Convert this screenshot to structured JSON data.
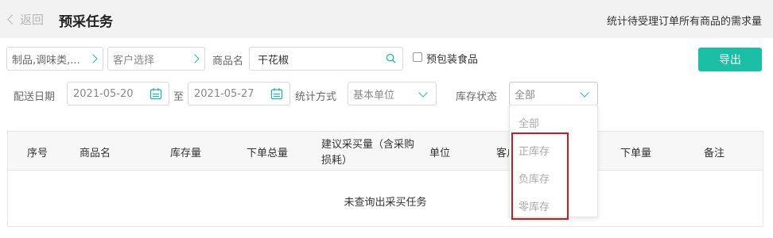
{
  "header": {
    "back_label": "返回",
    "title": "预采任务",
    "note": "统计待受理订单所有商品的需求量"
  },
  "filters": {
    "category_value": "制品,调味类,...",
    "customer_placeholder": "客户选择",
    "product_name_label": "商品名",
    "product_name_value": "干花椒",
    "prepackaged_label": "预包装食品",
    "export_label": "导出",
    "delivery_date_label": "配送日期",
    "date_from": "2021-05-20",
    "date_to_sep": "至",
    "date_to": "2021-05-27",
    "stat_method_label": "统计方式",
    "stat_method_value": "基本单位",
    "stock_status_label": "库存状态",
    "stock_status_value": "全部"
  },
  "stock_dropdown": {
    "options": [
      "全部",
      "正库存",
      "负库存",
      "零库存"
    ]
  },
  "table": {
    "headers": [
      "序号",
      "商品名",
      "库存量",
      "下单总量",
      "建议采买量（含采购损耗）",
      "单位",
      "客户",
      "下单量",
      "备注"
    ],
    "empty_text": "未查询出采买任务"
  },
  "colors": {
    "accent": "#1bbfa5",
    "highlight_box": "#d0191f"
  },
  "icons": [
    "chevron-left-icon",
    "chevron-right-icon",
    "search-icon",
    "calendar-icon",
    "chevron-down-icon"
  ]
}
